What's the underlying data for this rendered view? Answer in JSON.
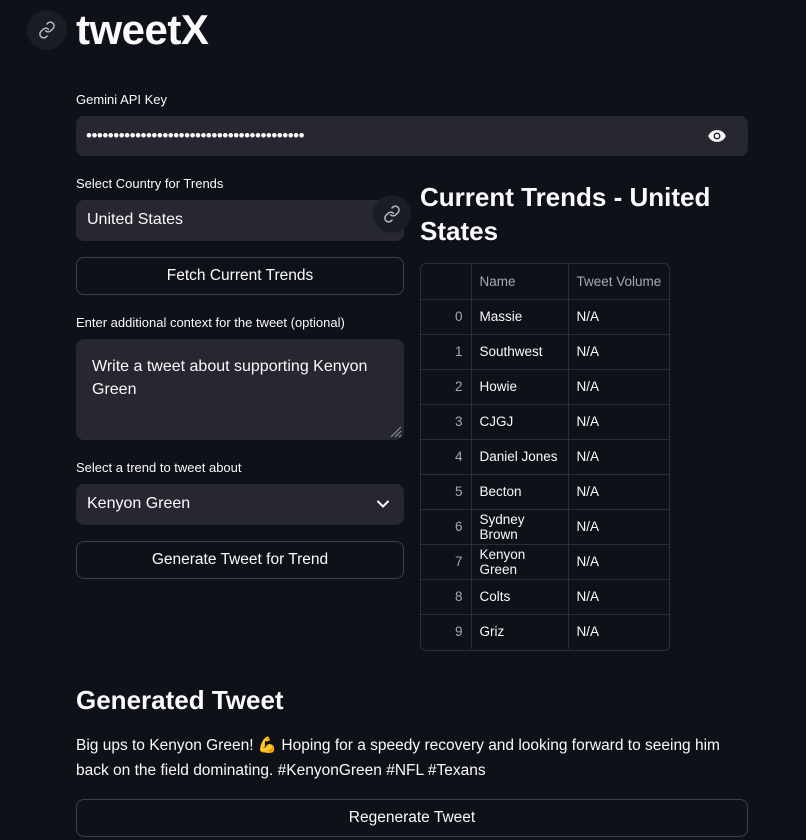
{
  "app": {
    "title": "tweetX"
  },
  "api_key": {
    "label": "Gemini API Key",
    "masked_value": "••••••••••••••••••••••••••••••••••••••••"
  },
  "country": {
    "label": "Select Country for Trends",
    "value": "United States"
  },
  "fetch_button": {
    "label": "Fetch Current Trends"
  },
  "context": {
    "label": "Enter additional context for the tweet (optional)",
    "value": "Write a tweet about supporting Kenyon Green"
  },
  "trend_select": {
    "label": "Select a trend to tweet about",
    "value": "Kenyon Green"
  },
  "generate_button": {
    "label": "Generate Tweet for Trend"
  },
  "trends": {
    "heading": "Current Trends - United States",
    "columns": [
      "",
      "Name",
      "Tweet Volume"
    ],
    "rows": [
      {
        "index": "0",
        "name": "Massie",
        "volume": "N/A"
      },
      {
        "index": "1",
        "name": "Southwest",
        "volume": "N/A"
      },
      {
        "index": "2",
        "name": "Howie",
        "volume": "N/A"
      },
      {
        "index": "3",
        "name": "CJGJ",
        "volume": "N/A"
      },
      {
        "index": "4",
        "name": "Daniel Jones",
        "volume": "N/A"
      },
      {
        "index": "5",
        "name": "Becton",
        "volume": "N/A"
      },
      {
        "index": "6",
        "name": "Sydney Brown",
        "volume": "N/A"
      },
      {
        "index": "7",
        "name": "Kenyon Green",
        "volume": "N/A"
      },
      {
        "index": "8",
        "name": "Colts",
        "volume": "N/A"
      },
      {
        "index": "9",
        "name": "Griz",
        "volume": "N/A"
      }
    ]
  },
  "generated": {
    "heading": "Generated Tweet",
    "text": "Big ups to Kenyon Green! 💪 Hoping for a speedy recovery and looking forward to seeing him back on the field dominating. #KenyonGreen #NFL #Texans"
  },
  "regen_button": {
    "label": "Regenerate Tweet"
  },
  "icons": {
    "title_anchor": "link-icon",
    "country_anchor": "link-icon",
    "password_toggle": "eye-icon",
    "select": "chevron-down-icon"
  },
  "colors": {
    "background": "#0e1117",
    "input": "#262730",
    "text": "#fafafa",
    "muted": "#a3a8b8"
  }
}
